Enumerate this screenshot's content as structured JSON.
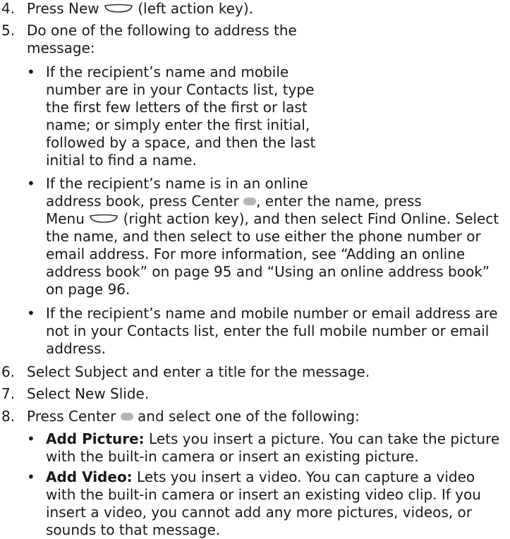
{
  "steps": [
    {
      "num": "4.",
      "prefix": "Press New",
      "suffix": "(left action key)."
    },
    {
      "num": "5.",
      "lines": [
        "Do one of the following to address the",
        "message:"
      ]
    },
    {
      "num": "6.",
      "text": "Select Subject and enter a title for the message."
    },
    {
      "num": "7.",
      "text": "Select New Slide."
    },
    {
      "num": "8.",
      "prefix": "Press Center",
      "suffix": "and select one of the following:"
    }
  ],
  "address_bullets": {
    "b1": [
      "If the recipient’s name and mobile",
      "number are in your Contacts list, type",
      "the first few letters of the first or last",
      "name; or simply enter the first initial,",
      "followed by a space, and then the last",
      "initial to find a name."
    ],
    "b2": {
      "l1": "If the recipient’s name is in an online",
      "l2_a": "address book, press Center",
      "l2_b": ", enter the name, press",
      "l3_a": "Menu",
      "l3_b": "(right action key), and then select Find Online. Select",
      "l4": "the name, and then select to use either the phone number or",
      "l5": "email address. For more information, see “Adding an online",
      "l6": "address book” on page 95 and “Using an online address book”",
      "l7": "on page 96."
    },
    "b3": [
      "If the recipient’s name and mobile number or email address are",
      "not in your Contacts list, enter the full mobile number or email",
      "address."
    ]
  },
  "option_bullets": {
    "pic": {
      "term": "Add Picture:",
      "l1": "Lets you insert a picture. You can take the picture",
      "l2": "with the built-in camera or insert an existing picture."
    },
    "vid": {
      "term": "Add Video:",
      "l1": "Lets you insert a video. You can capture a video",
      "l2": "with the built-in camera or insert an existing video clip. If you",
      "l3": "insert a video, you cannot add any more pictures, videos, or",
      "l4": "sounds to that message."
    }
  },
  "bullet_symbol": "•"
}
